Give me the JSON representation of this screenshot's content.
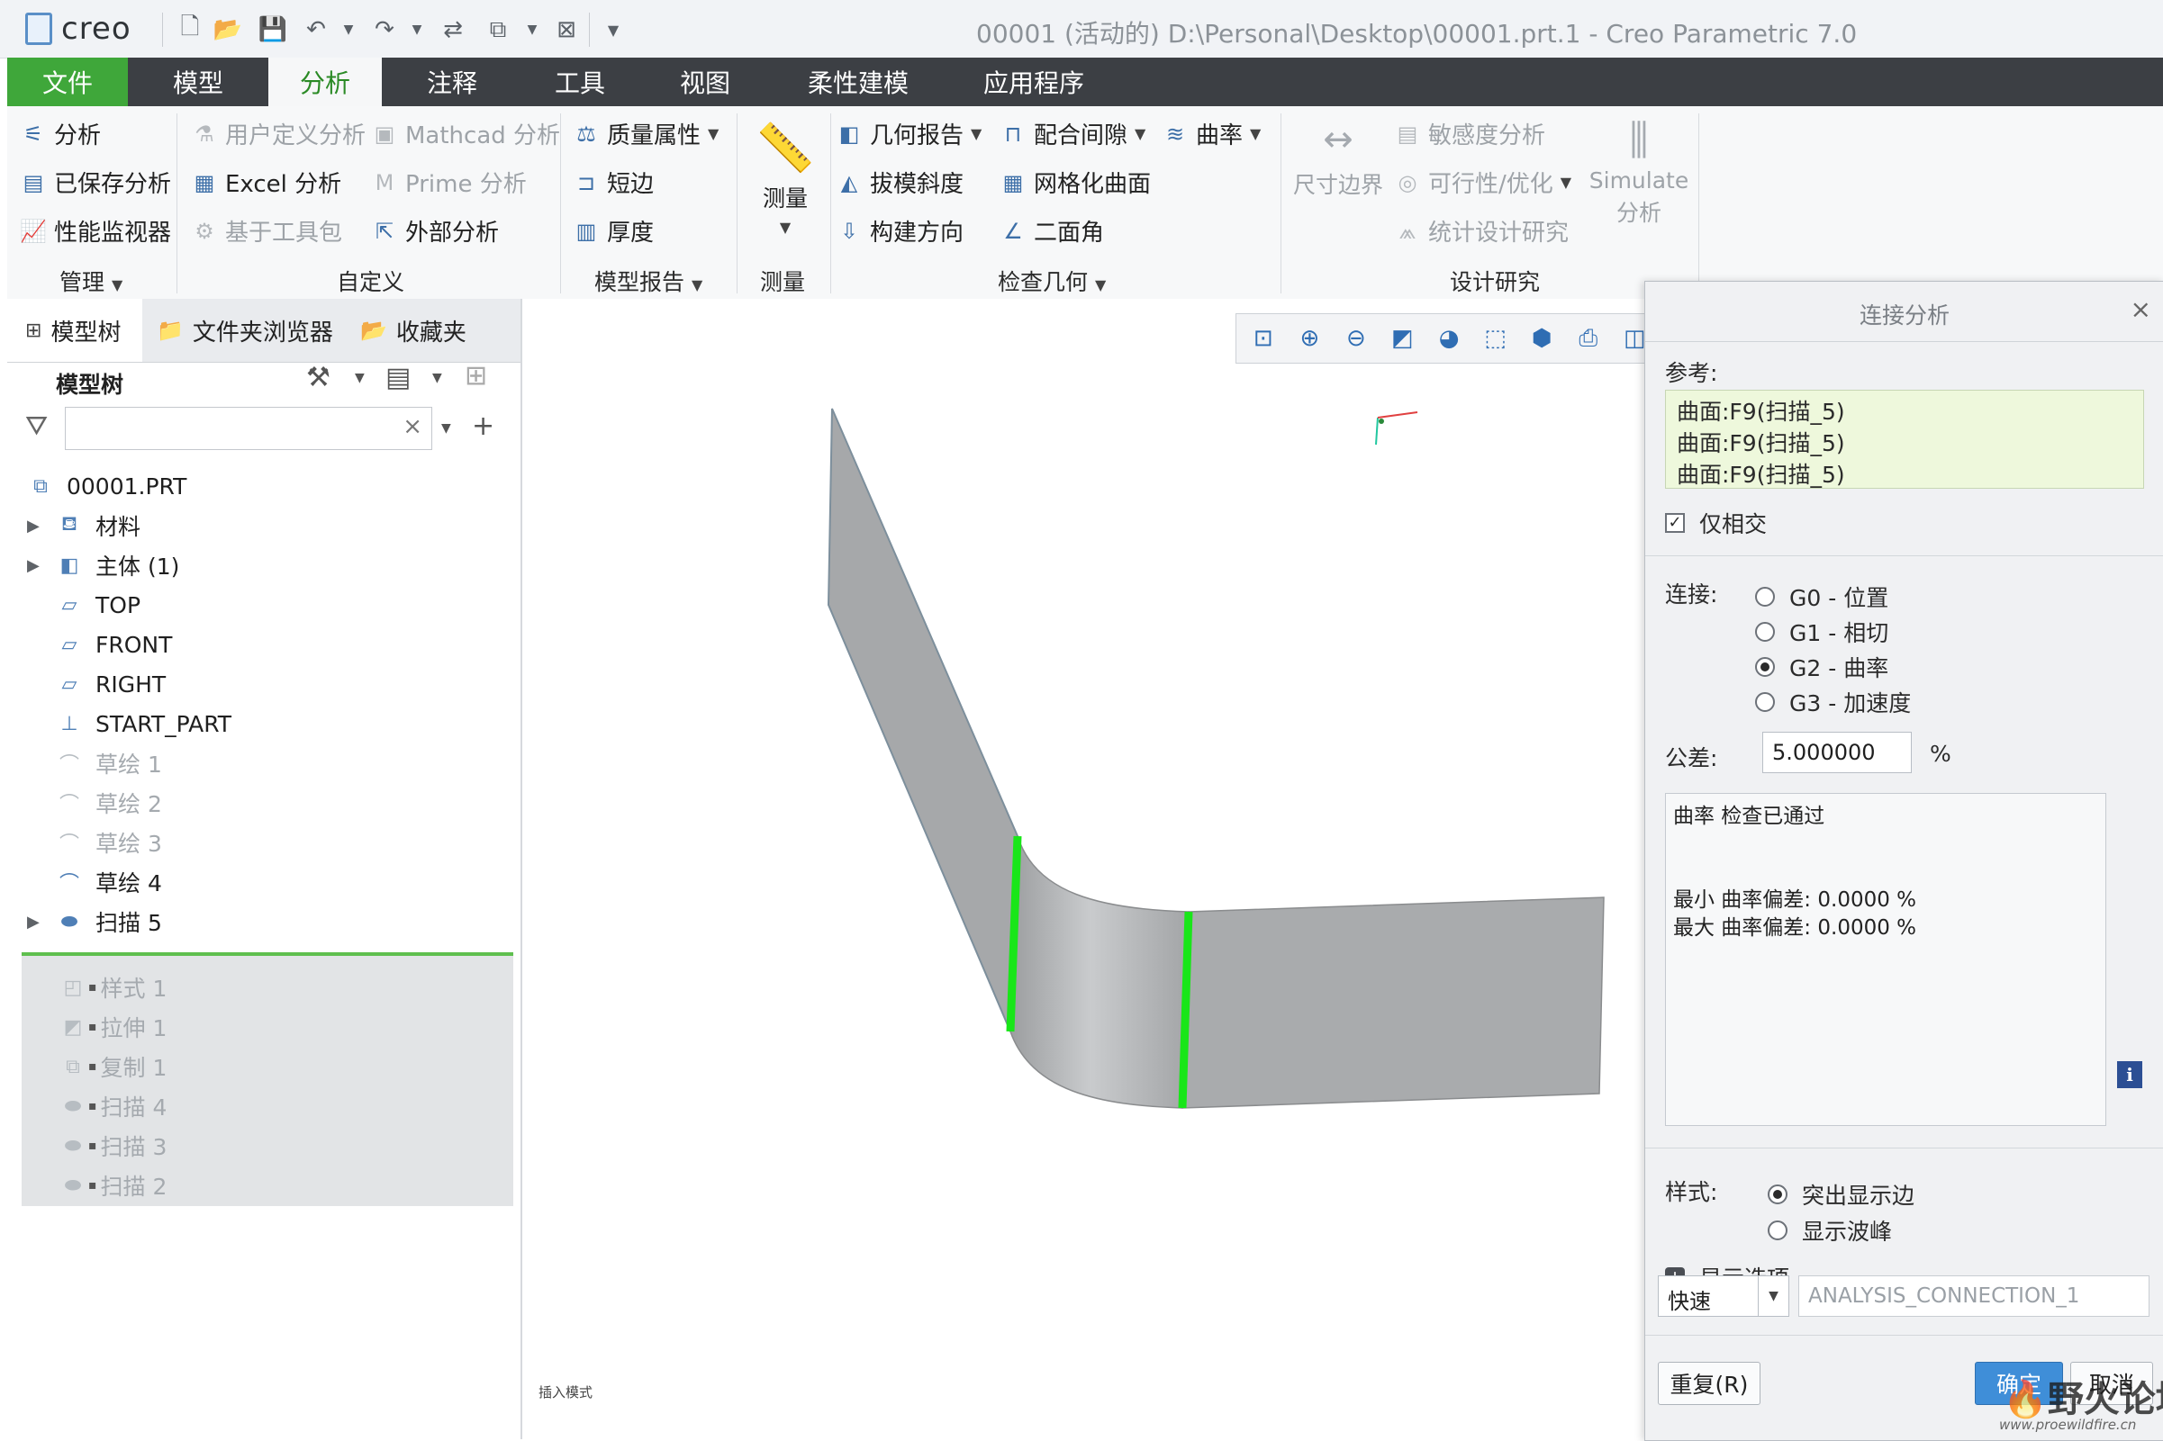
{
  "app": {
    "logo": "creo",
    "window_title": "00001 (活动的) D:\\Personal\\Desktop\\00001.prt.1 - Creo Parametric 7.0"
  },
  "menu": {
    "tabs": [
      "文件",
      "模型",
      "分析",
      "注释",
      "工具",
      "视图",
      "柔性建模",
      "应用程序"
    ],
    "active": "分析"
  },
  "ribbon": {
    "manage": {
      "items": [
        "分析",
        "已保存分析",
        "性能监视器"
      ],
      "label": "管理"
    },
    "custom": {
      "items": [
        "用户定义分析",
        "Excel 分析",
        "基于工具包",
        "Mathcad 分析",
        "Prime 分析",
        "外部分析"
      ],
      "label": "自定义"
    },
    "model_report": {
      "items": [
        "质量属性",
        "短边",
        "厚度"
      ],
      "label": "模型报告"
    },
    "measure": {
      "button": "测量",
      "label": "测量"
    },
    "inspect": {
      "items": [
        "几何报告",
        "拔模斜度",
        "构建方向",
        "配合间隙",
        "网格化曲面",
        "二面角",
        "曲率"
      ],
      "label": "检查几何"
    },
    "design": {
      "dim_boundary": "尺寸边界",
      "items": [
        "敏感度分析",
        "可行性/优化",
        "统计设计研究"
      ],
      "simulate_1": "Simulate",
      "simulate_2": "分析",
      "label": "设计研究"
    }
  },
  "left_panel": {
    "tabs": [
      "模型树",
      "文件夹浏览器",
      "收藏夹"
    ],
    "header": "模型树",
    "filter_placeholder": "",
    "tree": [
      {
        "label": "00001.PRT",
        "icon": "part-icon",
        "expand": false,
        "disabled": false
      },
      {
        "label": "材料",
        "icon": "material-icon",
        "expand": true,
        "disabled": false
      },
      {
        "label": "主体 (1)",
        "icon": "body-icon",
        "expand": true,
        "disabled": false
      },
      {
        "label": "TOP",
        "icon": "datum-plane-icon",
        "expand": false,
        "disabled": false
      },
      {
        "label": "FRONT",
        "icon": "datum-plane-icon",
        "expand": false,
        "disabled": false
      },
      {
        "label": "RIGHT",
        "icon": "datum-plane-icon",
        "expand": false,
        "disabled": false
      },
      {
        "label": "START_PART",
        "icon": "csys-icon",
        "expand": false,
        "disabled": false
      },
      {
        "label": "草绘 1",
        "icon": "sketch-icon",
        "expand": false,
        "disabled": true
      },
      {
        "label": "草绘 2",
        "icon": "sketch-icon",
        "expand": false,
        "disabled": true
      },
      {
        "label": "草绘 3",
        "icon": "sketch-icon",
        "expand": false,
        "disabled": true
      },
      {
        "label": "草绘 4",
        "icon": "sketch-icon",
        "expand": false,
        "disabled": false
      },
      {
        "label": "扫描 5",
        "icon": "sweep-icon",
        "expand": true,
        "disabled": false
      }
    ],
    "suppressed": [
      {
        "label": "样式 1",
        "icon": "style-icon"
      },
      {
        "label": "拉伸 1",
        "icon": "extrude-icon"
      },
      {
        "label": "复制 1",
        "icon": "copy-icon"
      },
      {
        "label": "扫描 4",
        "icon": "sweep-icon"
      },
      {
        "label": "扫描 3",
        "icon": "sweep-icon"
      },
      {
        "label": "扫描 2",
        "icon": "sweep-icon"
      }
    ]
  },
  "graphics": {
    "status_text": "插入模式"
  },
  "dialog": {
    "title": "连接分析",
    "ref_label": "参考:",
    "refs": [
      "曲面:F9(扫描_5)",
      "曲面:F9(扫描_5)",
      "曲面:F9(扫描_5)"
    ],
    "only_intersect": "仅相交",
    "conn_label": "连接:",
    "options": [
      "G0 - 位置",
      "G1 - 相切",
      "G2 - 曲率",
      "G3 - 加速度"
    ],
    "selected_option": 2,
    "tol_label": "公差:",
    "tol_value": "5.000000",
    "tol_unit": "%",
    "result_line1": "曲率 检查已通过",
    "result_line2": "最小 曲率偏差: 0.0000 %",
    "result_line3": "最大 曲率偏差: 0.0000 %",
    "style_label": "样式:",
    "style_opts": [
      "突出显示边",
      "显示波峰"
    ],
    "display_options": "显示选项",
    "speed": "快速",
    "analysis_name": "ANALYSIS_CONNECTION_1",
    "repeat_btn": "重复(R)",
    "ok_btn": "确定",
    "cancel_btn": "取消"
  },
  "watermark": {
    "text": "野火论坛",
    "url": "www.proewildfire.cn"
  },
  "colors": {
    "accent_green": "#3fa73a",
    "menubar": "#3c3f44",
    "surface": "#a9abad",
    "highlight_edge": "#19e619",
    "ref_bg": "#eef8dc"
  }
}
